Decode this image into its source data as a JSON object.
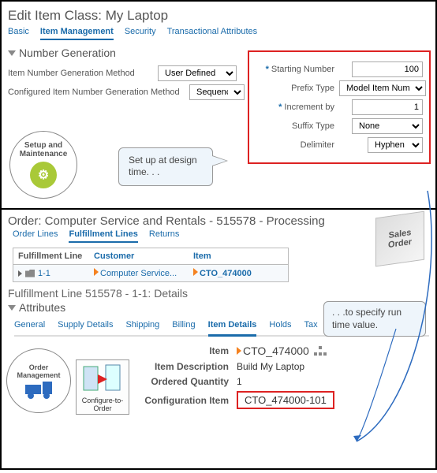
{
  "top": {
    "title": "Edit Item Class: My Laptop",
    "tabs": [
      "Basic",
      "Item Management",
      "Security",
      "Transactional Attributes"
    ],
    "active_tab": 1,
    "section": "Number Generation",
    "gen_method_label": "Item Number Generation Method",
    "gen_method_value": "User Defined",
    "cfg_method_label": "Configured Item Number Generation Method",
    "cfg_method_value": "Sequence",
    "setup_label": "Setup and Maintenance",
    "callout": "Set up at design time. . .",
    "params": {
      "starting_label": "Starting Number",
      "starting_value": "100",
      "prefix_label": "Prefix Type",
      "prefix_value": "Model Item Number",
      "increment_label": "Increment by",
      "increment_value": "1",
      "suffix_label": "Suffix Type",
      "suffix_value": "None",
      "delim_label": "Delimiter",
      "delim_value": "Hyphen"
    }
  },
  "bottom": {
    "title": "Order: Computer Service and Rentals - 515578 - Processing",
    "tabs": [
      "Order Lines",
      "Fulfillment Lines",
      "Returns"
    ],
    "active_tab": 1,
    "sales_badge": "Sales Order",
    "grid": {
      "headers": [
        "Fulfillment Line",
        "Customer",
        "Item"
      ],
      "row": {
        "fl": "1-1",
        "customer": "Computer Service...",
        "item": "CTO_474000"
      }
    },
    "detail_title": "Fulfillment Line 515578 - 1-1: Details",
    "attr_heading": "Attributes",
    "attr_tabs": [
      "General",
      "Supply Details",
      "Shipping",
      "Billing",
      "Item Details",
      "Holds",
      "Tax"
    ],
    "attr_active": 4,
    "item_label": "Item",
    "item_value": "CTO_474000",
    "desc_label": "Item Description",
    "desc_value": "Build My Laptop",
    "qty_label": "Ordered Quantity",
    "qty_value": "1",
    "cfg_label": "Configuration Item",
    "cfg_value": "CTO_474000-101",
    "callout": ". . .to specify run time value.",
    "order_label": "Order Management",
    "cto_label": "Configure-to-Order"
  }
}
